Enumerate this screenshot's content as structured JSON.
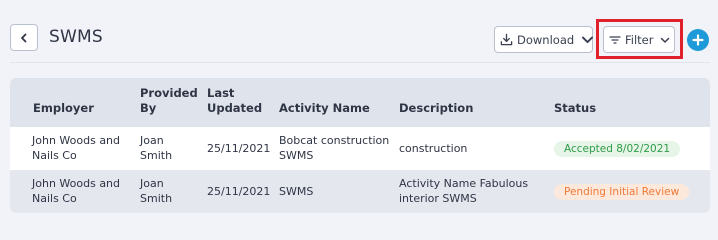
{
  "header": {
    "title": "SWMS",
    "download_label": "Download",
    "filter_label": "Filter"
  },
  "table": {
    "columns": [
      "Employer",
      "Provided By",
      "Last Updated",
      "Activity Name",
      "Description",
      "Status"
    ],
    "columns_display": {
      "employer": "Employer",
      "provided_by_1": "Provided",
      "provided_by_2": "By",
      "last_updated_1": "Last",
      "last_updated_2": "Updated",
      "activity_name": "Activity Name",
      "description": "Description",
      "status": "Status"
    },
    "rows": [
      {
        "employer_1": "John Woods and",
        "employer_2": "Nails Co",
        "provided_by_1": "Joan",
        "provided_by_2": "Smith",
        "last_updated": "25/11/2021",
        "activity_name_1": "Bobcat construction",
        "activity_name_2": "SWMS",
        "description_1": "construction",
        "status": "Accepted 8/02/2021",
        "status_color": "#2e9b48"
      },
      {
        "employer_1": "John Woods and",
        "employer_2": "Nails Co",
        "provided_by_1": "Joan",
        "provided_by_2": "Smith",
        "last_updated": "25/11/2021",
        "activity_name_1": "SWMS",
        "description_1": "Activity Name Fabulous",
        "description_2": "interior SWMS",
        "status": "Pending Initial Review",
        "status_color": "#ef7a38"
      }
    ]
  },
  "icons": {
    "back": "chevron-left-icon",
    "download": "download-icon",
    "filter": "filter-lines-icon",
    "add": "plus-icon"
  },
  "colors": {
    "accent": "#1f9ad9",
    "highlight": "#e0212b"
  }
}
